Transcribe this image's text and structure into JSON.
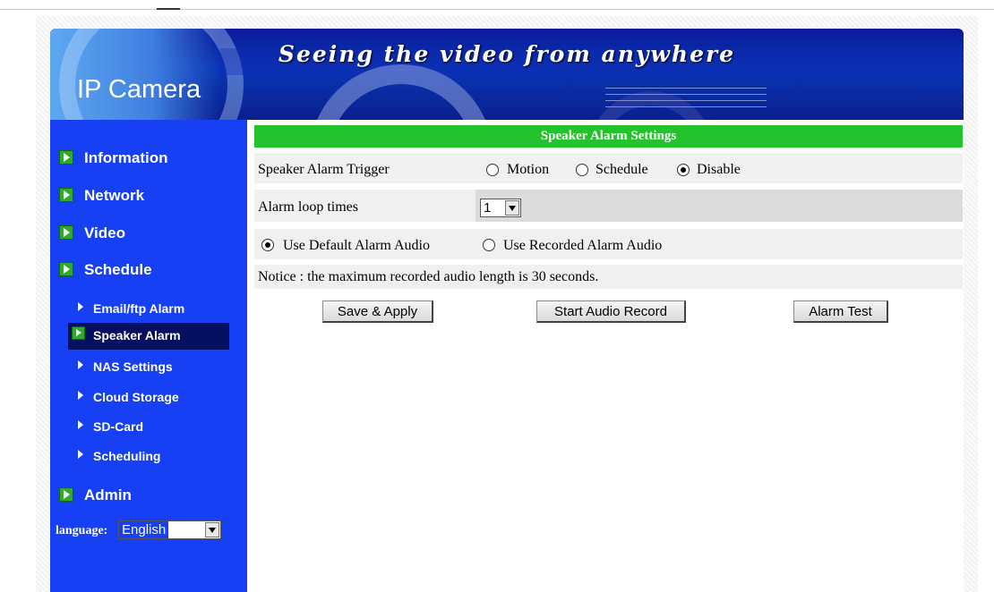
{
  "banner": {
    "slogan": "Seeing the video from anywhere",
    "logo": "IP Camera"
  },
  "sidebar": {
    "items": [
      {
        "label": "Information"
      },
      {
        "label": "Network"
      },
      {
        "label": "Video"
      },
      {
        "label": "Schedule"
      }
    ],
    "subitems": [
      {
        "label": "Email/ftp Alarm"
      },
      {
        "label": "Speaker Alarm",
        "active": true
      },
      {
        "label": "NAS Settings"
      },
      {
        "label": "Cloud Storage"
      },
      {
        "label": "SD-Card"
      },
      {
        "label": "Scheduling"
      }
    ],
    "admin": "Admin",
    "language_label": "language:",
    "language_value": "English"
  },
  "main": {
    "title": "Speaker Alarm Settings",
    "trigger": {
      "label": "Speaker Alarm Trigger",
      "options": [
        "Motion",
        "Schedule",
        "Disable"
      ],
      "selected": "Disable"
    },
    "loop": {
      "label": "Alarm loop times",
      "value": "1"
    },
    "audio": {
      "options": [
        "Use Default Alarm Audio",
        "Use Recorded Alarm Audio"
      ],
      "selected": "Use Default Alarm Audio"
    },
    "notice": "Notice : the maximum recorded audio length is 30 seconds.",
    "buttons": {
      "save": "Save & Apply",
      "record": "Start Audio Record",
      "test": "Alarm Test"
    }
  },
  "colors": {
    "sidebar": "#1740f4",
    "header": "#24c22c",
    "active_item": "#06105e"
  }
}
